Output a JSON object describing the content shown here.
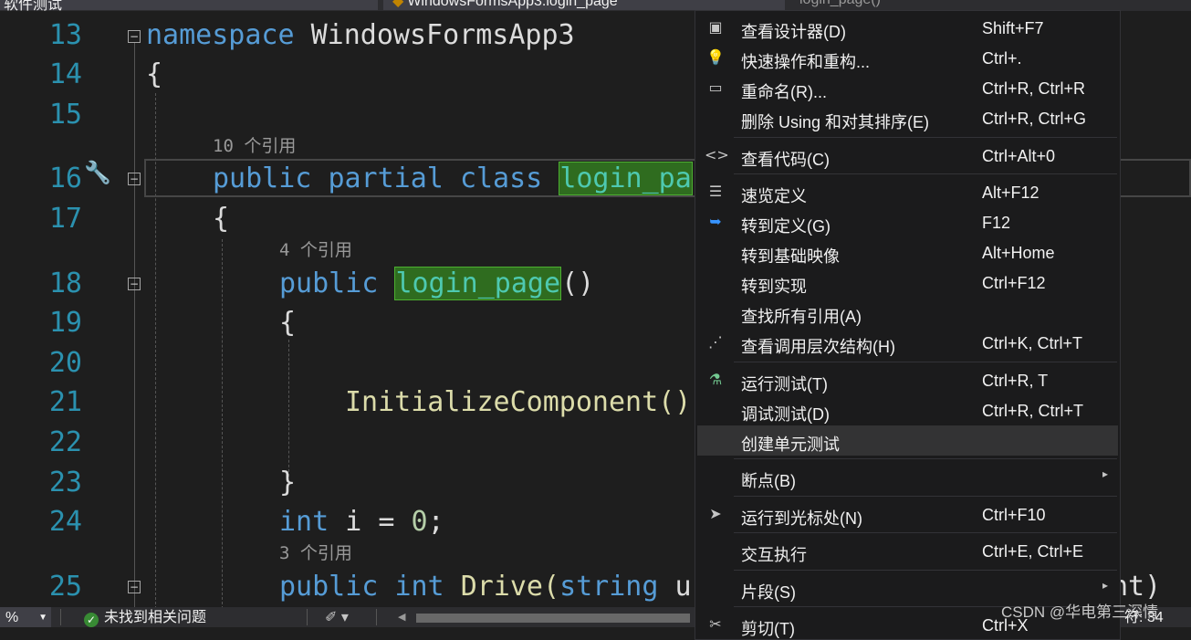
{
  "tabs": [
    {
      "label": "软件测试"
    },
    {
      "label": "WindowsFormsApp3.login_page"
    },
    {
      "label": "login_page()"
    }
  ],
  "editor": {
    "line_numbers": [
      "13",
      "14",
      "15",
      "16",
      "17",
      "18",
      "19",
      "20",
      "21",
      "22",
      "23",
      "24",
      "25"
    ],
    "codelens": [
      "10 个引用",
      "4 个引用",
      "3 个引用"
    ],
    "tokens": {
      "namespace_kw": "namespace",
      "namespace_name": "WindowsFormsApp3",
      "open_brace": "{",
      "close_brace": "}",
      "public_kw": "public",
      "partial_kw": "partial",
      "class_kw": "class",
      "class_name": "login_pa",
      "ctor_name": "login_page",
      "ctor_parens": "()",
      "init_call": "InitializeComponent()",
      "int_kw": "int",
      "var_decl": "i = ",
      "zero": "0",
      "semicolon": ";",
      "drive_name": "Drive(",
      "string_kw": "string",
      "param_start": "u",
      "trailing": "ht)"
    }
  },
  "context_menu": {
    "items": [
      {
        "icon": "designer-icon",
        "glyph": "▣",
        "label": "查看设计器(D)",
        "shortcut": "Shift+F7"
      },
      {
        "icon": "lightbulb-icon",
        "glyph": "💡",
        "label": "快速操作和重构...",
        "shortcut": "Ctrl+."
      },
      {
        "icon": "rename-icon",
        "glyph": "▭",
        "label": "重命名(R)...",
        "shortcut": "Ctrl+R, Ctrl+R"
      },
      {
        "icon": "",
        "glyph": "",
        "label": "删除 Using 和对其排序(E)",
        "shortcut": "Ctrl+R, Ctrl+G"
      },
      {
        "icon": "code-icon",
        "glyph": "<>",
        "label": "查看代码(C)",
        "shortcut": "Ctrl+Alt+0"
      },
      {
        "icon": "peek-definition-icon",
        "glyph": "☰",
        "label": "速览定义",
        "shortcut": "Alt+F12"
      },
      {
        "icon": "go-to-definition-icon",
        "glyph": "⮫",
        "label": "转到定义(G)",
        "shortcut": "F12"
      },
      {
        "icon": "",
        "glyph": "",
        "label": "转到基础映像",
        "shortcut": "Alt+Home"
      },
      {
        "icon": "",
        "glyph": "",
        "label": "转到实现",
        "shortcut": "Ctrl+F12"
      },
      {
        "icon": "",
        "glyph": "",
        "label": "查找所有引用(A)",
        "shortcut": ""
      },
      {
        "icon": "call-hierarchy-icon",
        "glyph": "⋰",
        "label": "查看调用层次结构(H)",
        "shortcut": "Ctrl+K, Ctrl+T"
      },
      {
        "icon": "run-tests-icon",
        "glyph": "⚗",
        "label": "运行测试(T)",
        "shortcut": "Ctrl+R, T"
      },
      {
        "icon": "",
        "glyph": "",
        "label": "调试测试(D)",
        "shortcut": "Ctrl+R, Ctrl+T"
      },
      {
        "icon": "",
        "glyph": "",
        "label": "创建单元测试",
        "shortcut": ""
      },
      {
        "icon": "",
        "glyph": "",
        "label": "断点(B)",
        "shortcut": ""
      },
      {
        "icon": "cursor-icon",
        "glyph": "➤",
        "label": "运行到光标处(N)",
        "shortcut": "Ctrl+F10"
      },
      {
        "icon": "",
        "glyph": "",
        "label": "交互执行",
        "shortcut": "Ctrl+E, Ctrl+E"
      },
      {
        "icon": "",
        "glyph": "",
        "label": "片段(S)",
        "shortcut": ""
      },
      {
        "icon": "cut-icon",
        "glyph": "✂",
        "label": "剪切(T)",
        "shortcut": "Ctrl+X"
      }
    ],
    "hovered_label": "创建单元测试",
    "submenu_arrow": "▸"
  },
  "statusbar": {
    "zoom": "%",
    "issues": "未找到相关问题",
    "col": "符: 34"
  },
  "watermark": "CSDN @华电第三深情",
  "colors": {
    "background": "#1e1e1e",
    "keyword": "#569cd6",
    "type": "#4ec9b0",
    "method": "#dcdcaa",
    "number": "#b5cea8",
    "line_number": "#2b91af",
    "highlight": "#2f6c1f"
  }
}
